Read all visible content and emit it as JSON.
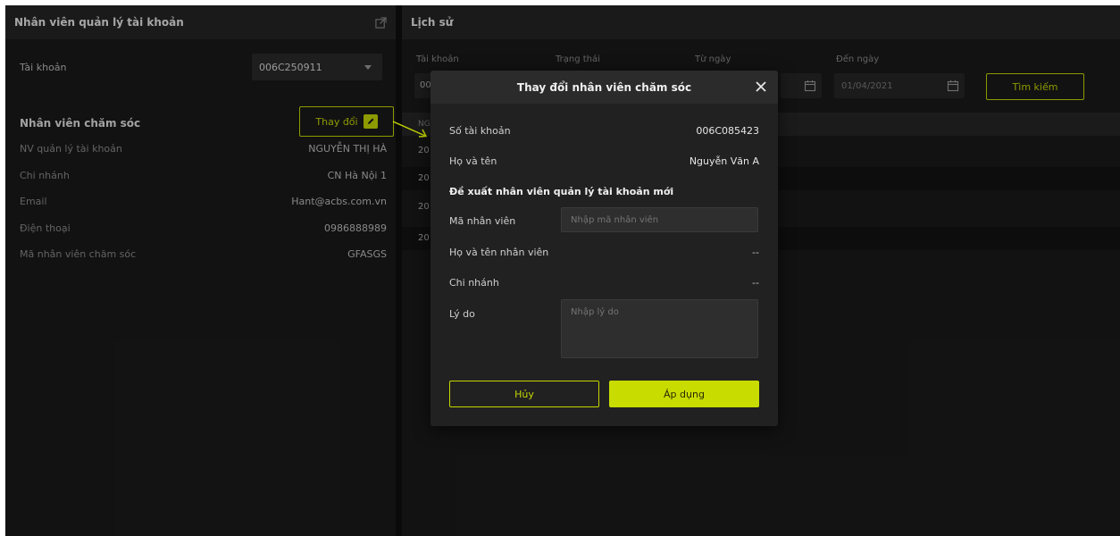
{
  "left_panel": {
    "title": "Nhân viên quản lý tài khoản",
    "account_label": "Tài khoản",
    "account_value": "006C250911",
    "section_title": "Nhân viên chăm sóc",
    "change_button": "Thay đổi",
    "details": [
      {
        "label": "NV quản lý tài khoản",
        "value": "NGUYỄN THỊ HÀ"
      },
      {
        "label": "Chi nhánh",
        "value": "CN Hà Nội 1"
      },
      {
        "label": "Email",
        "value": "Hant@acbs.com.vn"
      },
      {
        "label": "Điện thoại",
        "value": "0986888989"
      },
      {
        "label": "Mã nhân viên chăm sóc",
        "value": "GFASGS"
      }
    ]
  },
  "history_panel": {
    "title": "Lịch sử",
    "filters": {
      "account_label": "Tài khoản",
      "account_value": "00",
      "status_label": "Trạng thái",
      "from_label": "Từ ngày",
      "to_label": "Đến ngày",
      "to_value": "01/04/2021"
    },
    "search_button": "Tìm kiếm",
    "table_header": "NG",
    "rows": [
      "20",
      "20",
      "20",
      "20"
    ]
  },
  "modal": {
    "title": "Thay đổi nhân viên chăm sóc",
    "account_label": "Số tài khoản",
    "account_value": "006C085423",
    "name_label": "Họ và tên",
    "name_value": "Nguyễn Văn A",
    "subtitle": "Đề xuất nhân viên quản lý tài khoản mới",
    "emp_code_label": "Mã nhân viên",
    "emp_code_placeholder": "Nhập mã nhân viên",
    "emp_name_label": "Họ và tên nhân viên",
    "emp_name_value": "--",
    "branch_label": "Chi nhánh",
    "branch_value": "--",
    "reason_label": "Lý do",
    "reason_placeholder": "Nhập lý do",
    "cancel_button": "Hủy",
    "apply_button": "Áp dụng"
  },
  "colors": {
    "accent": "#c4d600",
    "background": "#0f0f0f",
    "panel": "#1a1a1a"
  }
}
